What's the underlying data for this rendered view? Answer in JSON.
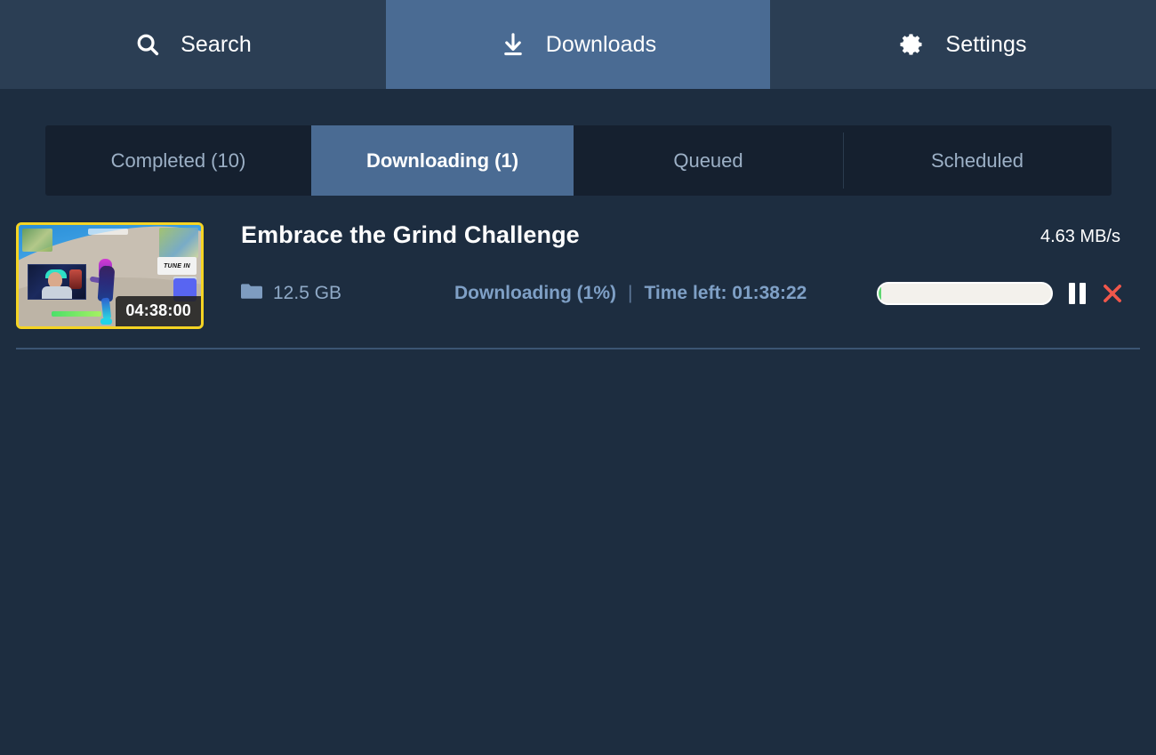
{
  "app": {
    "accent_blue": "#4a6b93",
    "background": "#1d2d40",
    "panel_dark": "#15202f",
    "nav_background": "#2b3e54"
  },
  "navbar": {
    "items": [
      {
        "id": "search",
        "label": "Search",
        "icon": "search-icon",
        "active": false
      },
      {
        "id": "downloads",
        "label": "Downloads",
        "icon": "download-icon",
        "active": true
      },
      {
        "id": "settings",
        "label": "Settings",
        "icon": "gear-icon",
        "active": false
      }
    ]
  },
  "tabs": {
    "items": [
      {
        "id": "completed",
        "label": "Completed (10)",
        "active": false
      },
      {
        "id": "downloading",
        "label": "Downloading (1)",
        "active": true
      },
      {
        "id": "queued",
        "label": "Queued",
        "active": false
      },
      {
        "id": "scheduled",
        "label": "Scheduled",
        "active": false
      }
    ]
  },
  "downloads": {
    "items": [
      {
        "title": "Embrace the Grind Challenge",
        "duration": "04:38:00",
        "size": "12.5 GB",
        "speed": "4.63 MB/s",
        "status": "Downloading (1%)",
        "separator": "|",
        "time_left": "Time left: 01:38:22",
        "progress_percent": 1,
        "progress_fill_color": "#5fd672",
        "thumbnail_border_color": "#f5d423",
        "thumbnail_overlay_text": "TUNE IN",
        "controls": {
          "pause_label": "pause-button",
          "cancel_label": "cancel-button"
        }
      }
    ]
  }
}
